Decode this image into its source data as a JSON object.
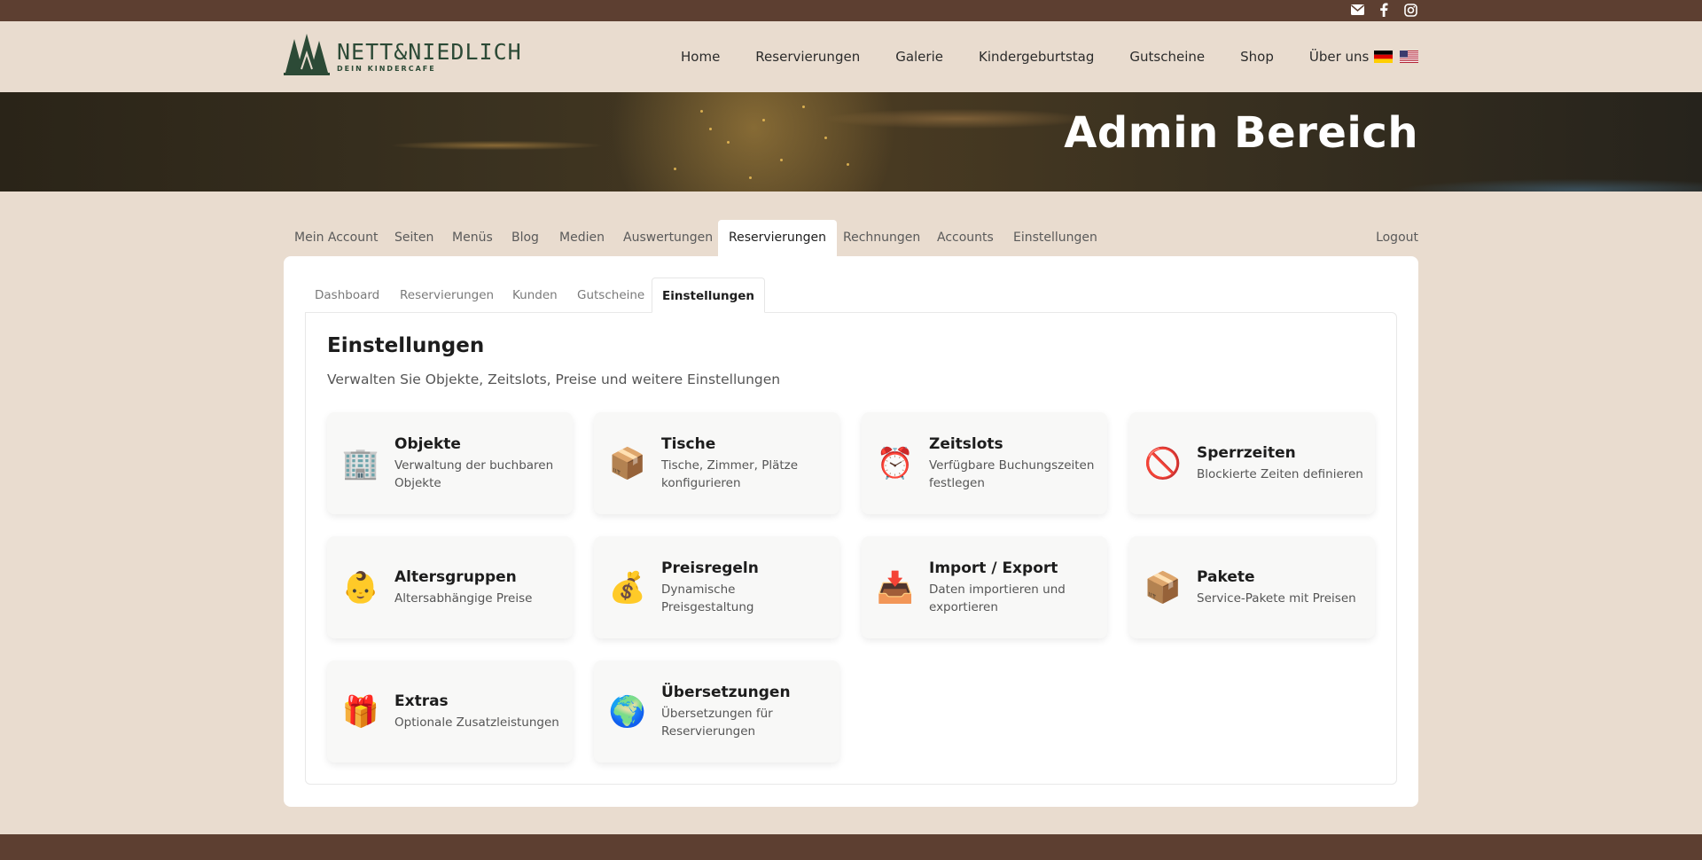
{
  "topbar": {
    "icons": [
      "mail-icon",
      "facebook-icon",
      "instagram-icon"
    ]
  },
  "brand": {
    "name": "NETT&NIEDLICH",
    "tagline": "DEIN KINDERCAFE"
  },
  "nav": {
    "items": [
      "Home",
      "Reservierungen",
      "Galerie",
      "Kindergeburtstag",
      "Gutscheine",
      "Shop",
      "Über uns"
    ]
  },
  "hero": {
    "title": "Admin Bereich"
  },
  "admin_tabs": {
    "items": [
      "Mein Account",
      "Seiten",
      "Menüs",
      "Blog",
      "Medien",
      "Auswertungen",
      "Reservierungen",
      "Rechnungen",
      "Accounts",
      "Einstellungen"
    ],
    "active": "Reservierungen",
    "logout": "Logout"
  },
  "sub_tabs": {
    "items": [
      "Dashboard",
      "Reservierungen",
      "Kunden",
      "Gutscheine",
      "Einstellungen"
    ],
    "active": "Einstellungen"
  },
  "settings": {
    "title": "Einstellungen",
    "description": "Verwalten Sie Objekte, Zeitslots, Preise und weitere Einstellungen",
    "tiles": [
      {
        "emoji": "🏢",
        "icon": "office-building-icon",
        "title": "Objekte",
        "desc": "Verwaltung der buchbaren Objekte"
      },
      {
        "emoji": "📦",
        "icon": "package-icon",
        "title": "Tische",
        "desc": "Tische, Zimmer, Plätze konfigurieren"
      },
      {
        "emoji": "⏰",
        "icon": "alarm-clock-icon",
        "title": "Zeitslots",
        "desc": "Verfügbare Buchungszeiten festlegen"
      },
      {
        "emoji": "🚫",
        "icon": "prohibited-icon",
        "title": "Sperrzeiten",
        "desc": "Blockierte Zeiten definieren"
      },
      {
        "emoji": "👶",
        "icon": "baby-icon",
        "title": "Altersgruppen",
        "desc": "Altersabhängige Preise"
      },
      {
        "emoji": "💰",
        "icon": "money-bag-icon",
        "title": "Preisregeln",
        "desc": "Dynamische Preisgestaltung"
      },
      {
        "emoji": "📥",
        "icon": "inbox-tray-icon",
        "title": "Import / Export",
        "desc": "Daten importieren und exportieren"
      },
      {
        "emoji": "📦",
        "icon": "package-icon",
        "title": "Pakete",
        "desc": "Service-Pakete mit Preisen"
      },
      {
        "emoji": "🎁",
        "icon": "gift-icon",
        "title": "Extras",
        "desc": "Optionale Zusatzleistungen"
      },
      {
        "emoji": "🌍",
        "icon": "globe-icon",
        "title": "Übersetzungen",
        "desc": "Übersetzungen für Reservierungen"
      }
    ]
  },
  "colors": {
    "brown": "#5d3f31",
    "beige": "#e9dccf",
    "brand_green": "#2c4a36"
  }
}
